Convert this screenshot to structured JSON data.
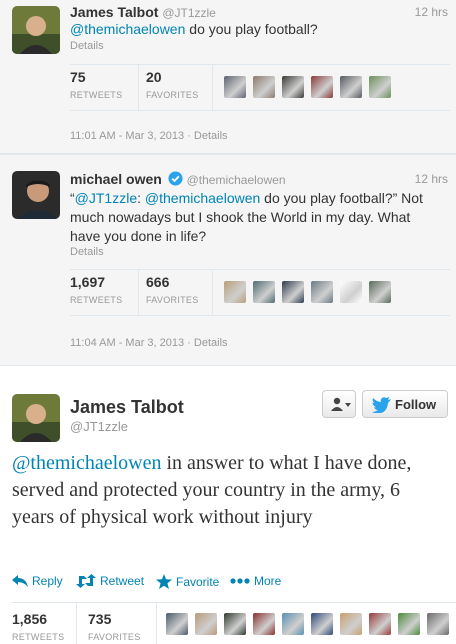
{
  "tweet1": {
    "name": "James Talbot",
    "handle": "@JT1zzle",
    "time": "12 hrs",
    "mention": "@themichaelowen",
    "text": " do you play football?",
    "details": "Details",
    "retweets": "75",
    "retweets_label": "RETWEETS",
    "favorites": "20",
    "favorites_label": "FAVORITES",
    "timestamp": "11:01 AM - Mar 3, 2013 · ",
    "timestamp_details": "Details",
    "face_colors": [
      "#5d6470",
      "#8c7a6e",
      "#3c3a36",
      "#8a3a3a",
      "#555a60",
      "#6b8f5a"
    ]
  },
  "tweet2": {
    "name": "michael owen",
    "verified_icon": "verified-badge-icon",
    "handle": "@themichaelowen",
    "time": "12 hrs",
    "quote_open": "“",
    "mention1": "@JT1zzle",
    "sep": ": ",
    "mention2": "@themichaelowen",
    "text": " do you play football?” Not much nowadays but I shook the World in my day. What have you done in life?",
    "details": "Details",
    "retweets": "1,697",
    "retweets_label": "RETWEETS",
    "favorites": "666",
    "favorites_label": "FAVORITES",
    "timestamp": "11:04 AM - Mar 3, 2013 · ",
    "timestamp_details": "Details",
    "face_colors": [
      "#b9a07a",
      "#4f6b73",
      "#2f3b4d",
      "#6a7a86",
      "#ffffff",
      "#5a6a5a"
    ]
  },
  "tweet3": {
    "name": "James Talbot",
    "handle": "@JT1zzle",
    "follow_label": "Follow",
    "mention": "@themichaelowen",
    "text": " in answer to what I have done, served and protected your country in the army, 6 years of physical work without injury",
    "reply_label": "Reply",
    "retweet_label": "Retweet",
    "favorite_label": "Favorite",
    "more_label": "More",
    "retweets": "1,856",
    "retweets_label": "RETWEETS",
    "favorites": "735",
    "favorites_label": "FAVORITES",
    "face_colors": [
      "#4a5a6a",
      "#b89a7a",
      "#2e3a2e",
      "#8a2f2f",
      "#5a8fb0",
      "#2e4a7a",
      "#c8a070",
      "#9a3a3a",
      "#4a8a3a",
      "#6a6a6a"
    ]
  },
  "colors": {
    "link": "#0084b4",
    "verified": "#2aa3ef",
    "follow_bird": "#2aa3ef"
  }
}
